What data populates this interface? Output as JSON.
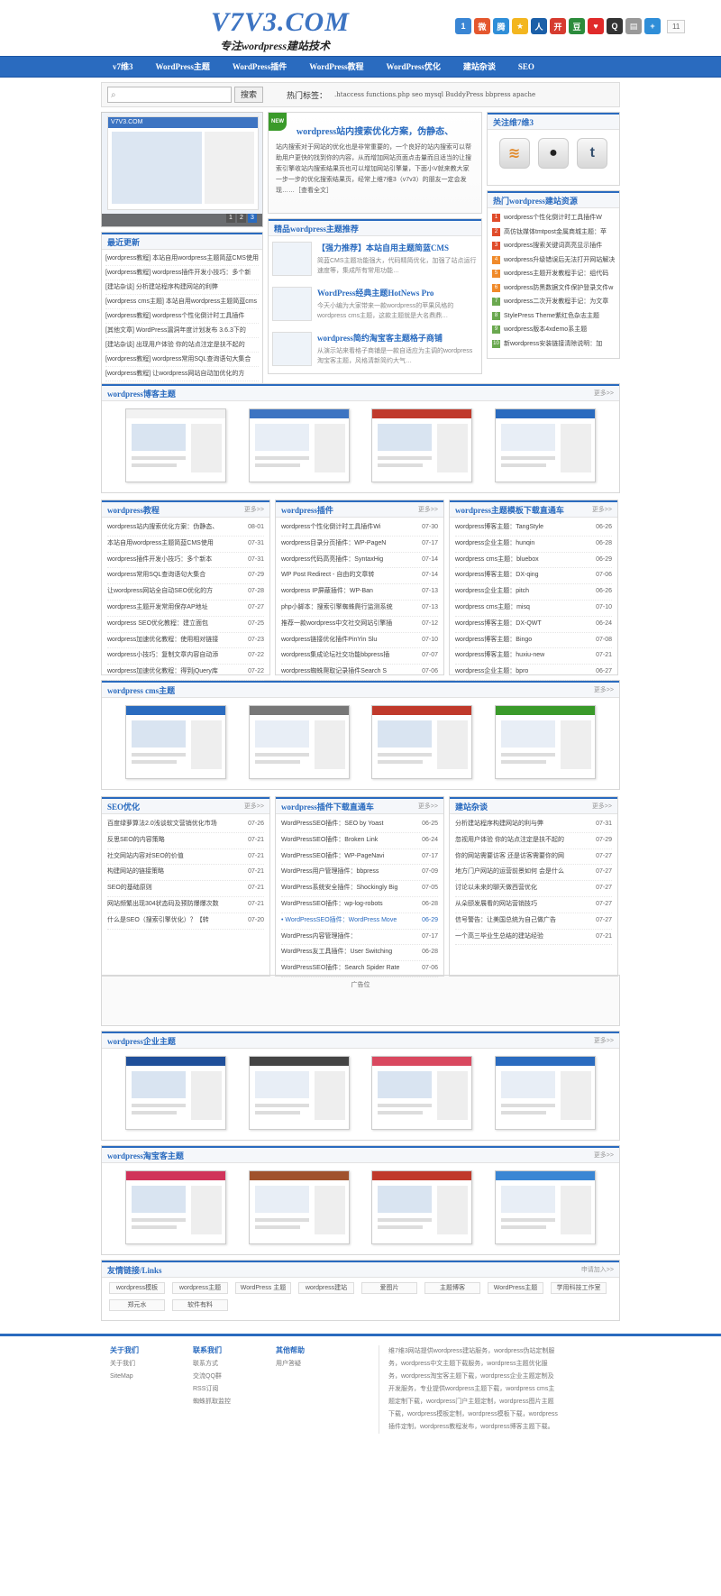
{
  "header": {
    "logo": "V7V3.COM",
    "tagline": "专注wordpress建站技术",
    "share_count": "11"
  },
  "share": [
    {
      "icon": "qzone-icon",
      "color": "#3a86d4",
      "glyph": "1"
    },
    {
      "icon": "weibo-icon",
      "color": "#e4572e",
      "glyph": "微"
    },
    {
      "icon": "tencent-weibo-icon",
      "color": "#2f8ed8",
      "glyph": "腾"
    },
    {
      "icon": "star-icon",
      "color": "#f3b61f",
      "glyph": "★"
    },
    {
      "icon": "renren-icon",
      "color": "#1b5fa8",
      "glyph": "人"
    },
    {
      "icon": "kaixin-icon",
      "color": "#d63b2f",
      "glyph": "开"
    },
    {
      "icon": "douban-icon",
      "color": "#2c8c3c",
      "glyph": "豆"
    },
    {
      "icon": "heart-icon",
      "color": "#e02a2a",
      "glyph": "♥"
    },
    {
      "icon": "qq-icon",
      "color": "#333333",
      "glyph": "Q"
    },
    {
      "icon": "copy-icon",
      "color": "#999999",
      "glyph": "▤"
    },
    {
      "icon": "plus-icon",
      "color": "#2f8ed8",
      "glyph": "+"
    }
  ],
  "nav": [
    "v7维3",
    "WordPress主题",
    "WordPress插件",
    "WordPress教程",
    "WordPress优化",
    "建站杂谈",
    "SEO"
  ],
  "search": {
    "button": "搜索",
    "hot_label": "热门标签：",
    "hot_tags": ".htaccess functions.php seo mysql BuddyPress bbpress apache"
  },
  "slider": {
    "site": "V7V3.COM",
    "pages": [
      "1",
      "2",
      "3"
    ]
  },
  "latest": {
    "title": "最近更新",
    "items": [
      "[wordpress教程] 本站自用wordpress主题简蓝CMS使用",
      "[wordpress教程] wordpress插件开发小技巧：多个新",
      "[建站杂谈] 分析建站程序构建网站的利弊",
      "[wordpress cms主题] 本站自用wordpress主题简蓝cms",
      "[wordpress教程] wordpress个性化倒计时工具插件",
      "[其他文章] WordPress漏洞年度计划发布 3.6.3下的",
      "[建站杂谈] 出现用户体验 你的站点注定是扶不起的",
      "[wordpress教程] wordpress常用SQL查询语句大集合",
      "[wordpress教程] 让wordpress网站自动加优化的方"
    ]
  },
  "featured": {
    "badge": "NEW",
    "title": "wordpress站内搜索优化方案，伪静态、",
    "text": "站内搜索对于网站的优化也是非常重要的，一个良好的站内搜索可以帮助用户更快的找到你的内容，从而增加网站页面点击量而且适当的让搜索引擎收站内搜索结果页也可以增加网站引擎量，下面小V就来教大家一步一步的优化搜索结果页，经常上维7维3（v7v3）的朋友一定会发现……［查看全文］"
  },
  "picks": {
    "title": "精品wordpress主题推荐",
    "items": [
      {
        "title": "【强力推荐】本站自用主题简蓝CMS",
        "text": "简蓝CMS主题功能强大，代码精简优化，加强了站点运行速度等，集成所有常用功能…"
      },
      {
        "title": "WordPress经典主题HotNews Pro",
        "text": "今天小编为大家带来一款wordpress的苹果风格的wordpress cms主题，这款主题就是大名鼎鼎…"
      },
      {
        "title": "wordpress简约淘宝客主题格子商铺",
        "text": "从演示站来看格子商铺是一款自适应为主调的wordpress淘宝客主题，风格清新简约大气…"
      }
    ]
  },
  "follow": {
    "title": "关注维7维3",
    "icons": [
      {
        "name": "rss-icon",
        "glyph": "≋"
      },
      {
        "name": "penguin-icon",
        "glyph": "●"
      },
      {
        "name": "tumblr-icon",
        "glyph": "t"
      }
    ]
  },
  "hot": {
    "title": "热门wordpress建站资源",
    "items": [
      {
        "n": "1",
        "t": "wordpress个性化倒计时工具插件W"
      },
      {
        "n": "2",
        "t": "高仿钛媒体tmtpost金属商城主题：苹"
      },
      {
        "n": "3",
        "t": "wordpress搜索关键词高亮显示插件"
      },
      {
        "n": "4",
        "t": "wordpress升级错误后无法打开网站解决"
      },
      {
        "n": "5",
        "t": "wordpress主题开发教程手记：组代码"
      },
      {
        "n": "6",
        "t": "wordpress防黑数据文件保护登录文件w"
      },
      {
        "n": "7",
        "t": "wordpress二次开发教程手记：为文章"
      },
      {
        "n": "8",
        "t": "StylePress Theme紫红色杂志主题"
      },
      {
        "n": "9",
        "t": "wordpress版本4xdemo系主题"
      },
      {
        "n": "10",
        "t": "新wordpress安装链接清除说明：加"
      }
    ]
  },
  "sec_blog": {
    "title": "wordpress博客主题",
    "more": "更多>>"
  },
  "cols1": [
    {
      "title": "wordpress教程",
      "more": "更多>>",
      "items": [
        {
          "t": "wordpress站内搜索优化方案：伪静态、",
          "d": "08-01"
        },
        {
          "t": "本站自用wordpress主题简蓝CMS使用",
          "d": "07-31"
        },
        {
          "t": "wordpress插件开发小技巧：多个新本",
          "d": "07-31"
        },
        {
          "t": "wordpress常用SQL查询语句大集合",
          "d": "07-29"
        },
        {
          "t": "让wordpress网站全自动SEO优化的方",
          "d": "07-28"
        },
        {
          "t": "wordpress主题开发常用保存AP地址",
          "d": "07-27"
        },
        {
          "t": "wordpress SEO优化教程：建立面包",
          "d": "07-25"
        },
        {
          "t": "wordpress加速优化教程：使用相对链接",
          "d": "07-23"
        },
        {
          "t": "wordpress小技巧：复制文章内容自动添",
          "d": "07-22"
        },
        {
          "t": "wordpress加速优化教程：得到jQuery库",
          "d": "07-22"
        }
      ]
    },
    {
      "title": "wordpress插件",
      "more": "更多>>",
      "items": [
        {
          "t": "wordpress个性化倒计时工具插件Wi",
          "d": "07-30"
        },
        {
          "t": "wordpress目录分页插件：WP-PageN",
          "d": "07-17"
        },
        {
          "t": "wordpress代码高亮插件：SyntaxHig",
          "d": "07-14"
        },
        {
          "t": "WP Post Redirect - 自由的文章转",
          "d": "07-14"
        },
        {
          "t": "wordpress IP屏蔽插件：WP-Ban",
          "d": "07-13"
        },
        {
          "t": "php小脚本：搜索引擎蜘蛛爬行监测系统",
          "d": "07-13"
        },
        {
          "t": "推荐一款wordpress中文社交网站引擎插",
          "d": "07-12"
        },
        {
          "t": "wordpress链接优化插件PinYin Slu",
          "d": "07-10"
        },
        {
          "t": "wordpress集成论坛社交功能bbpress插",
          "d": "07-07"
        },
        {
          "t": "wordpress蜘蛛爬取记录插件Search S",
          "d": "07-06"
        }
      ]
    },
    {
      "title": "wordpress主题模板下载直通车",
      "more": "更多>>",
      "items": [
        {
          "t": "wordpress博客主题：TangStyle",
          "d": "06-26"
        },
        {
          "t": "wordpress企业主题：hunqin",
          "d": "06-28"
        },
        {
          "t": "wordpress cms主题：bluebox",
          "d": "06-29"
        },
        {
          "t": "wordpress博客主题：DX-qing",
          "d": "07-06"
        },
        {
          "t": "wordpress企业主题：pitch",
          "d": "06-26"
        },
        {
          "t": "wordpress cms主题：misq",
          "d": "07-10"
        },
        {
          "t": "wordpress博客主题：DX-QWT",
          "d": "06-24"
        },
        {
          "t": "wordpress博客主题：Bingo",
          "d": "07-08"
        },
        {
          "t": "wordpress博客主题：huxiu-new",
          "d": "07-21"
        },
        {
          "t": "wordpress企业主题：bpro",
          "d": "06-27"
        }
      ]
    }
  ],
  "sec_cms": {
    "title": "wordpress cms主题",
    "more": "更多>>"
  },
  "cols2": [
    {
      "title": "SEO优化",
      "more": "更多>>",
      "items": [
        {
          "t": "百度绿萝算法2.0浅谈软文营销优化市场",
          "d": "07-26"
        },
        {
          "t": "反思SEO的内容策略",
          "d": "07-21"
        },
        {
          "t": "社交网站内容对SEO的价值",
          "d": "07-21"
        },
        {
          "t": "构建网站的链接策略",
          "d": "07-21"
        },
        {
          "t": "SEO的基础原则",
          "d": "07-21"
        },
        {
          "t": "网站频繁出现304状态码及预防爆爆次数",
          "d": "07-21"
        },
        {
          "t": "什么是SEO（搜索引擎优化）？【转",
          "d": "07-20"
        }
      ]
    },
    {
      "title": "wordpress插件下载直通车",
      "more": "更多>>",
      "items": [
        {
          "t": "WordPressSEO插件：SEO by Yoast",
          "d": "06-25"
        },
        {
          "t": "WordPressSEO插件：Broken Link",
          "d": "06-24"
        },
        {
          "t": "WordPressSEO插件：WP-PageNavi",
          "d": "07-17"
        },
        {
          "t": "WordPress用户管理插件：bbpress",
          "d": "07-09"
        },
        {
          "t": "WordPress系统安全插件：Shockingly Big",
          "d": "07-05"
        },
        {
          "t": "WordPressSEO插件：wp-log-robots",
          "d": "06-28"
        },
        {
          "t": "• WordPressSEO插件：WordPress Move",
          "d": "06-29",
          "hl": true
        },
        {
          "t": "WordPress内容管理插件：",
          "d": "07-17"
        },
        {
          "t": "WordPress友工具插件：User Switching",
          "d": "06-28"
        },
        {
          "t": "WordPressSEO插件：Search Spider Rate",
          "d": "07-06"
        }
      ]
    },
    {
      "title": "建站杂谈",
      "more": "更多>>",
      "items": [
        {
          "t": "分析建站程序构建网站的利与弊",
          "d": "07-31"
        },
        {
          "t": "忽视用户体验 你的站点注定是扶不起的",
          "d": "07-29"
        },
        {
          "t": "你的网站需要访客 还是访客需要你的网",
          "d": "07-27"
        },
        {
          "t": "地方门户网站的运营前景如何 会是什么",
          "d": "07-27"
        },
        {
          "t": "讨论以未来的聊天做西营优化",
          "d": "07-27"
        },
        {
          "t": "从朵颐发展看的网站营销技巧",
          "d": "07-27"
        },
        {
          "t": "信号警告：让美国总统为自己做广告",
          "d": "07-27"
        },
        {
          "t": "一个高三毕业生总结的建站经验",
          "d": "07-21"
        }
      ]
    }
  ],
  "ad": {
    "label": "广告位"
  },
  "sec_ent": {
    "title": "wordpress企业主题",
    "more": "更多>>"
  },
  "sec_tb": {
    "title": "wordpress淘宝客主题",
    "more": "更多>>"
  },
  "links": {
    "title": "友情链接/Links",
    "apply": "申请加入>>",
    "items": [
      "wordpress模板",
      "wordpress主题",
      "WordPress 主题",
      "wordpress建站",
      "爱图片",
      "主题博客",
      "WordPress主题",
      "学用科技工作室",
      "郑元水",
      "软件有料"
    ]
  },
  "footer": {
    "cols": [
      {
        "title": "关于我们",
        "items": [
          "关于我们",
          "SiteMap"
        ]
      },
      {
        "title": "联系我们",
        "items": [
          "联系方式",
          "交流QQ群",
          "RSS订阅",
          "蜘蛛抓取监控"
        ]
      },
      {
        "title": "其他帮助",
        "items": [
          "用户答疑"
        ]
      }
    ],
    "desc": "维7维3网站提供wordpress建站服务，wordpress伪站定制服务，wordpress中文主题下载服务，wordpress主题优化服务，wordpress淘宝客主题下载，wordpress企业主题定制及开发服务，专业提供wordpress主题下载，wordpress cms主题定制下载，wordpress门户主题定制，wordpress图片主题下载，wordpress模板定制，wordpress模板下载，wordpress插件定制，wordpress教程发布，wordpress博客主题下载。"
  }
}
